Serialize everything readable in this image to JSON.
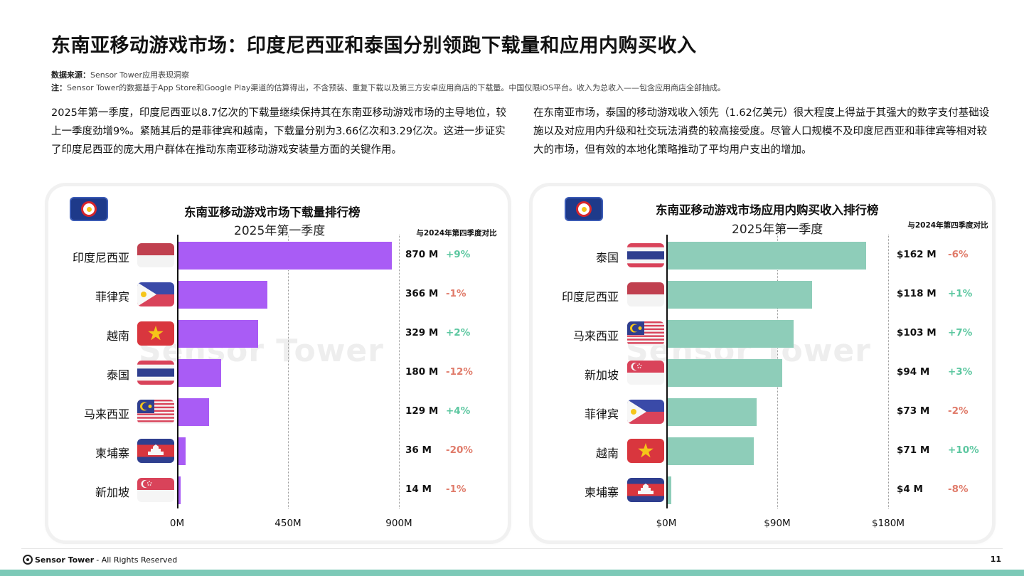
{
  "title": "东南亚移动游戏市场：印度尼西亚和泰国分别领跑下载量和应用内购买收入",
  "source": {
    "label": "数据来源：",
    "text": "Sensor Tower应用表现洞察",
    "note_label": "注：",
    "note_text": "Sensor Tower的数据基于App Store和Google Play渠道的估算得出，不含预装、重复下载以及第三方安卓应用商店的下载量。中国仅限iOS平台。收入为总收入——包含应用商店全部抽成。"
  },
  "paragraphs": {
    "left": "2025年第一季度，印度尼西亚以8.7亿次的下载量继续保持其在东南亚移动游戏市场的主导地位，较上一季度劲增9%。紧随其后的是菲律宾和越南，下载量分别为3.66亿次和3.29亿次。这进一步证实了印度尼西亚的庞大用户群体在推动东南亚移动游戏安装量方面的关键作用。",
    "right": "在东南亚市场，泰国的移动游戏收入领先（1.62亿美元）很大程度上得益于其强大的数字支付基础设施以及对应用内升级和社交玩法消费的较高接受度。尽管人口规模不及印度尼西亚和菲律宾等相对较大的市场，但有效的本地化策略推动了平均用户支出的增加。"
  },
  "watermark": "Sensor Tower",
  "chart_data": [
    {
      "type": "bar",
      "orientation": "horizontal",
      "title": "东南亚移动游戏市场下载量排行榜",
      "subtitle": "2025年第一季度",
      "change_header": "与2024年第四季度对比",
      "categories": [
        "印度尼西亚",
        "菲律宾",
        "越南",
        "泰国",
        "马来西亚",
        "柬埔寨",
        "新加坡"
      ],
      "flags": [
        "indonesia",
        "philippines",
        "vietnam",
        "thailand",
        "malaysia",
        "cambodia",
        "singapore"
      ],
      "values": [
        870,
        366,
        329,
        180,
        129,
        36,
        14
      ],
      "value_labels": [
        "870 M",
        "366 M",
        "329 M",
        "180 M",
        "129 M",
        "36 M",
        "14 M"
      ],
      "changes": [
        "+9%",
        "-1%",
        "+2%",
        "-12%",
        "+4%",
        "-20%",
        "-1%"
      ],
      "xlim": [
        0,
        900
      ],
      "xticks": [
        "0M",
        "450M",
        "900M"
      ],
      "xtick_values": [
        0,
        450,
        900
      ],
      "bar_color": "#a95cf5",
      "grid": true
    },
    {
      "type": "bar",
      "orientation": "horizontal",
      "title": "东南亚移动游戏市场应用内购买收入排行榜",
      "subtitle": "2025年第一季度",
      "change_header": "与2024年第四季度对比",
      "categories": [
        "泰国",
        "印度尼西亚",
        "马来西亚",
        "新加坡",
        "菲律宾",
        "越南",
        "柬埔寨"
      ],
      "flags": [
        "thailand",
        "indonesia",
        "malaysia",
        "singapore",
        "philippines",
        "vietnam",
        "cambodia"
      ],
      "values": [
        162,
        118,
        103,
        94,
        73,
        71,
        4
      ],
      "value_labels": [
        "$162 M",
        "$118 M",
        "$103 M",
        "$94 M",
        "$73 M",
        "$71 M",
        "$4 M"
      ],
      "changes": [
        "-6%",
        "+1%",
        "+7%",
        "+3%",
        "-2%",
        "+10%",
        "-8%"
      ],
      "xlim": [
        0,
        180
      ],
      "xticks": [
        "$0M",
        "$90M",
        "$180M"
      ],
      "xtick_values": [
        0,
        90,
        180
      ],
      "bar_color": "#8ecdb9",
      "grid": true
    }
  ],
  "footer": {
    "brand": "Sensor Tower",
    "rights": "- All Rights Reserved",
    "page": "11"
  },
  "colors": {
    "positive": "#5cc7a0",
    "negative": "#e07b6a",
    "band": "#7cc9b7"
  }
}
